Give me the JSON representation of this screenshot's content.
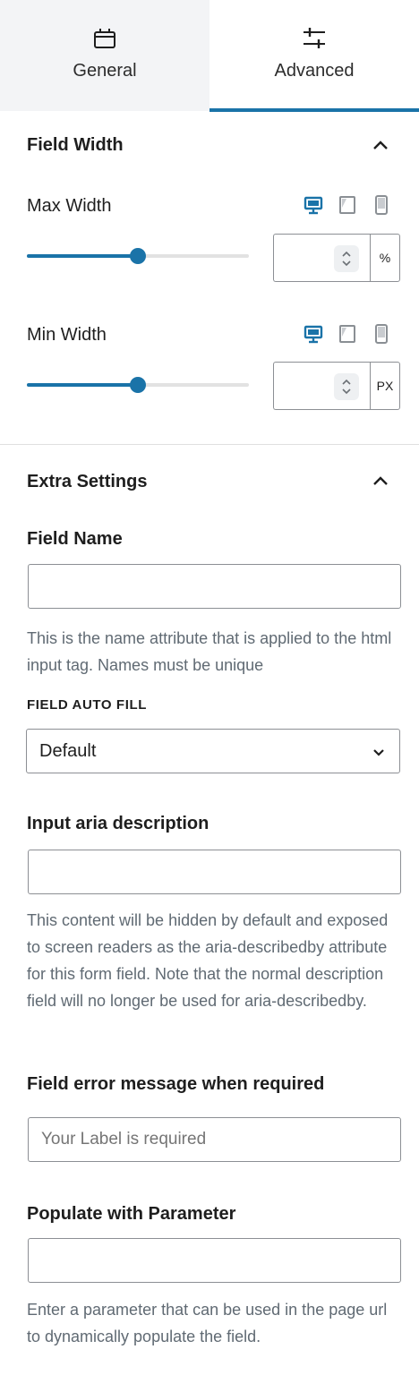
{
  "tabs": [
    {
      "label": "General",
      "icon": "calendar-icon",
      "active": false
    },
    {
      "label": "Advanced",
      "icon": "sliders-icon",
      "active": true
    }
  ],
  "colors": {
    "accent": "#1a73a8",
    "inactive_tab_bg": "#f3f4f6",
    "help_text": "#606a73"
  },
  "field_width": {
    "title": "Field Width",
    "max_width": {
      "label": "Max Width",
      "value": "",
      "unit": "%",
      "slider_percent": 50
    },
    "min_width": {
      "label": "Min Width",
      "value": "",
      "unit": "PX",
      "slider_percent": 50
    },
    "devices": [
      "desktop-icon",
      "tablet-icon",
      "mobile-icon"
    ],
    "active_device": "desktop"
  },
  "extra_settings": {
    "title": "Extra Settings",
    "field_name": {
      "label": "Field Name",
      "value": "",
      "help": "This is the name attribute that is applied to the html input tag. Names must be unique"
    },
    "auto_fill": {
      "label": "FIELD AUTO FILL",
      "selected": "Default"
    },
    "aria_description": {
      "label": "Input aria description",
      "value": "",
      "help": "This content will be hidden by default and exposed to screen readers as the aria-describedby attribute for this form field. Note that the normal description field will no longer be used for aria-describedby."
    },
    "error_message": {
      "label": "Field error message when required",
      "value": "",
      "placeholder": "Your Label is required"
    },
    "parameter": {
      "label": "Populate with Parameter",
      "value": "",
      "help": "Enter a parameter that can be used in the page url to dynamically populate the field."
    }
  }
}
